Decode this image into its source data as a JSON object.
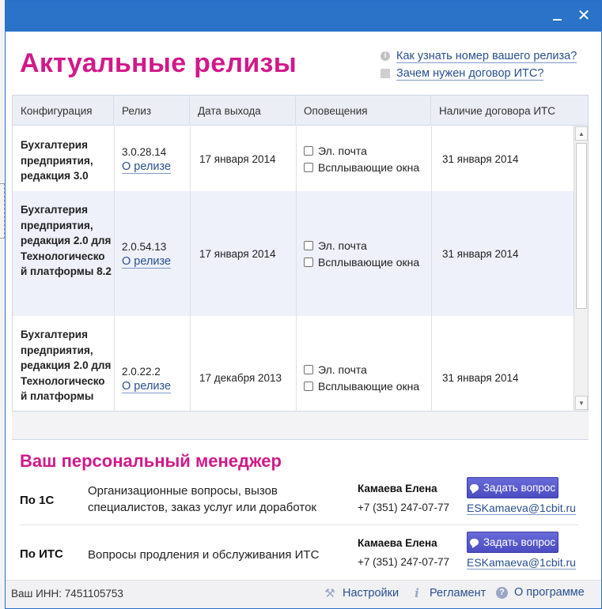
{
  "window": {
    "minimize_glyph": "—",
    "close_glyph": "✕"
  },
  "page_title": "Актуальные релизы",
  "help_links": [
    {
      "icon": "info-icon",
      "label": "Как узнать номер вашего релиза?"
    },
    {
      "icon": "document-icon",
      "label": "Зачем нужен договор ИТС?"
    }
  ],
  "table": {
    "columns": [
      "Конфигурация",
      "Релиз",
      "Дата выхода",
      "Оповещения",
      "Наличие договора ИТС"
    ],
    "rows": [
      {
        "configuration": "Бухгалтерия предприятия, редакция 3.0",
        "release": "3.0.28.14",
        "release_link": "О релизе",
        "date": "17 января 2014",
        "notify_email": "Эл. почта",
        "notify_popup": "Всплывающие окна",
        "its_date": "31 января 2014"
      },
      {
        "configuration": "Бухгалтерия предприятия, редакция 2.0 для Технологическо й платформы 8.2",
        "release": "2.0.54.13",
        "release_link": "О релизе",
        "date": "17 января 2014",
        "notify_email": "Эл. почта",
        "notify_popup": "Всплывающие окна",
        "its_date": "31 января 2014"
      },
      {
        "configuration": "Бухгалтерия предприятия, редакция 2.0 для Технологическо й платформы",
        "release": "2.0.22.2",
        "release_link": "О релизе",
        "date": "17 декабря 2013",
        "notify_email": "Эл. почта",
        "notify_popup": "Всплывающие окна",
        "its_date": "31 января 2014"
      }
    ],
    "scroll_up": "▲",
    "scroll_down": "▼"
  },
  "manager": {
    "title": "Ваш персональный менеджер",
    "rows": [
      {
        "label": "По 1С",
        "description": "Организационные вопросы, вызов специалистов, заказ услуг или доработок",
        "name": "Камаева Елена",
        "phone": "+7 (351) 247-07-77",
        "button": "Задать вопрос",
        "email": "ESKamaeva@1cbit.ru"
      },
      {
        "label": "По ИТС",
        "description": "Вопросы продления и обслуживания ИТС",
        "name": "Камаева Елена",
        "phone": "+7 (351) 247-07-77",
        "button": "Задать вопрос",
        "email": "ESKamaeva@1cbit.ru"
      }
    ]
  },
  "footer": {
    "inn": "Ваш ИНН: 7451105753",
    "settings": "Настройки",
    "regulations": "Регламент",
    "about": "О программе",
    "icons": {
      "settings": "tools-icon",
      "regulations": "info-icon",
      "about": "help-icon"
    }
  },
  "colors": {
    "accent": "#d1198a",
    "titlebar": "#2b73c9",
    "link": "#2a4f8f",
    "button": "#5556c9"
  }
}
